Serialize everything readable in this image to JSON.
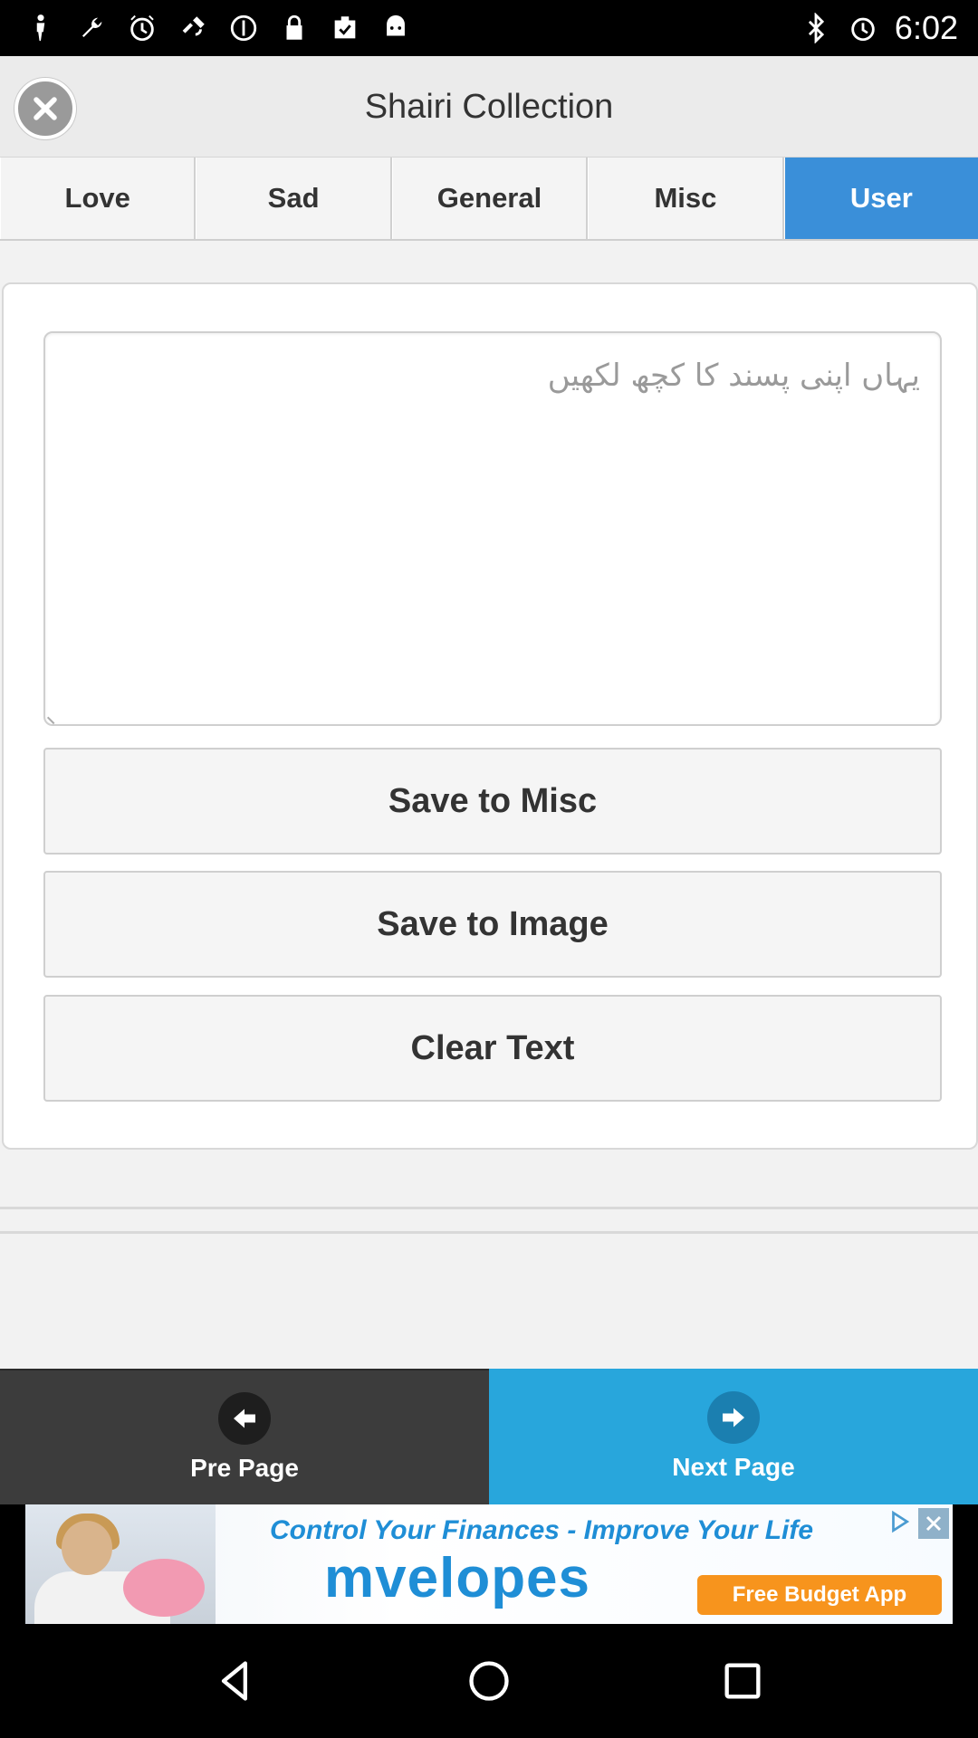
{
  "status_bar": {
    "time": "6:02",
    "left_icons": [
      "figure-icon",
      "wrench-icon",
      "alarm-icon",
      "satellite-icon",
      "circle-icon",
      "lock-icon",
      "clipboard-check-icon",
      "android-icon"
    ],
    "right_icons": [
      "bluetooth-icon",
      "alarm-icon"
    ]
  },
  "header": {
    "title": "Shairi Collection"
  },
  "tabs": [
    {
      "label": "Love",
      "active": false
    },
    {
      "label": "Sad",
      "active": false
    },
    {
      "label": "General",
      "active": false
    },
    {
      "label": "Misc",
      "active": false
    },
    {
      "label": "User",
      "active": true
    }
  ],
  "editor": {
    "placeholder": "یہاں اپنی پسند کا کچھ لکھیں",
    "value": ""
  },
  "actions": {
    "save_misc": "Save to Misc",
    "save_image": "Save to Image",
    "clear_text": "Clear Text"
  },
  "bottom_nav": {
    "prev_label": "Pre Page",
    "next_label": "Next Page"
  },
  "ad": {
    "headline": "Control Your Finances - Improve Your Life",
    "brand": "mvelopes",
    "cta": "Free Budget App"
  },
  "colors": {
    "accent_tab": "#3a8fd9",
    "next_button": "#28a6dc",
    "prev_button": "#3c3c3c"
  }
}
